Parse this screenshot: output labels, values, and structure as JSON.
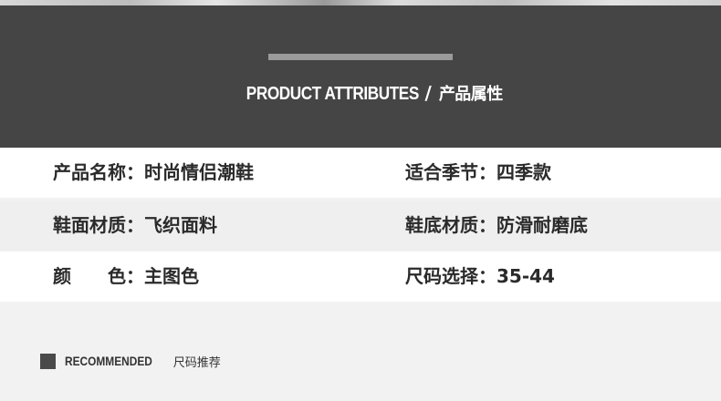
{
  "header": {
    "title_en": "PRODUCT ATTRIBUTES",
    "separator": "/",
    "title_cn": "产品属性"
  },
  "attributes": [
    {
      "left_label": "产品名称：",
      "left_value": "时尚情侣潮鞋",
      "right_label": "适合季节：",
      "right_value": "四季款"
    },
    {
      "left_label": "鞋面材质：",
      "left_value": "飞织面料",
      "right_label": "鞋底材质：",
      "right_value": "防滑耐磨底"
    },
    {
      "left_label": "颜　　色：",
      "left_value": "主图色",
      "right_label": "尺码选择：",
      "right_value": "35-44"
    }
  ],
  "recommended": {
    "label_en": "RECOMMENDED",
    "label_cn": "尺码推荐"
  }
}
